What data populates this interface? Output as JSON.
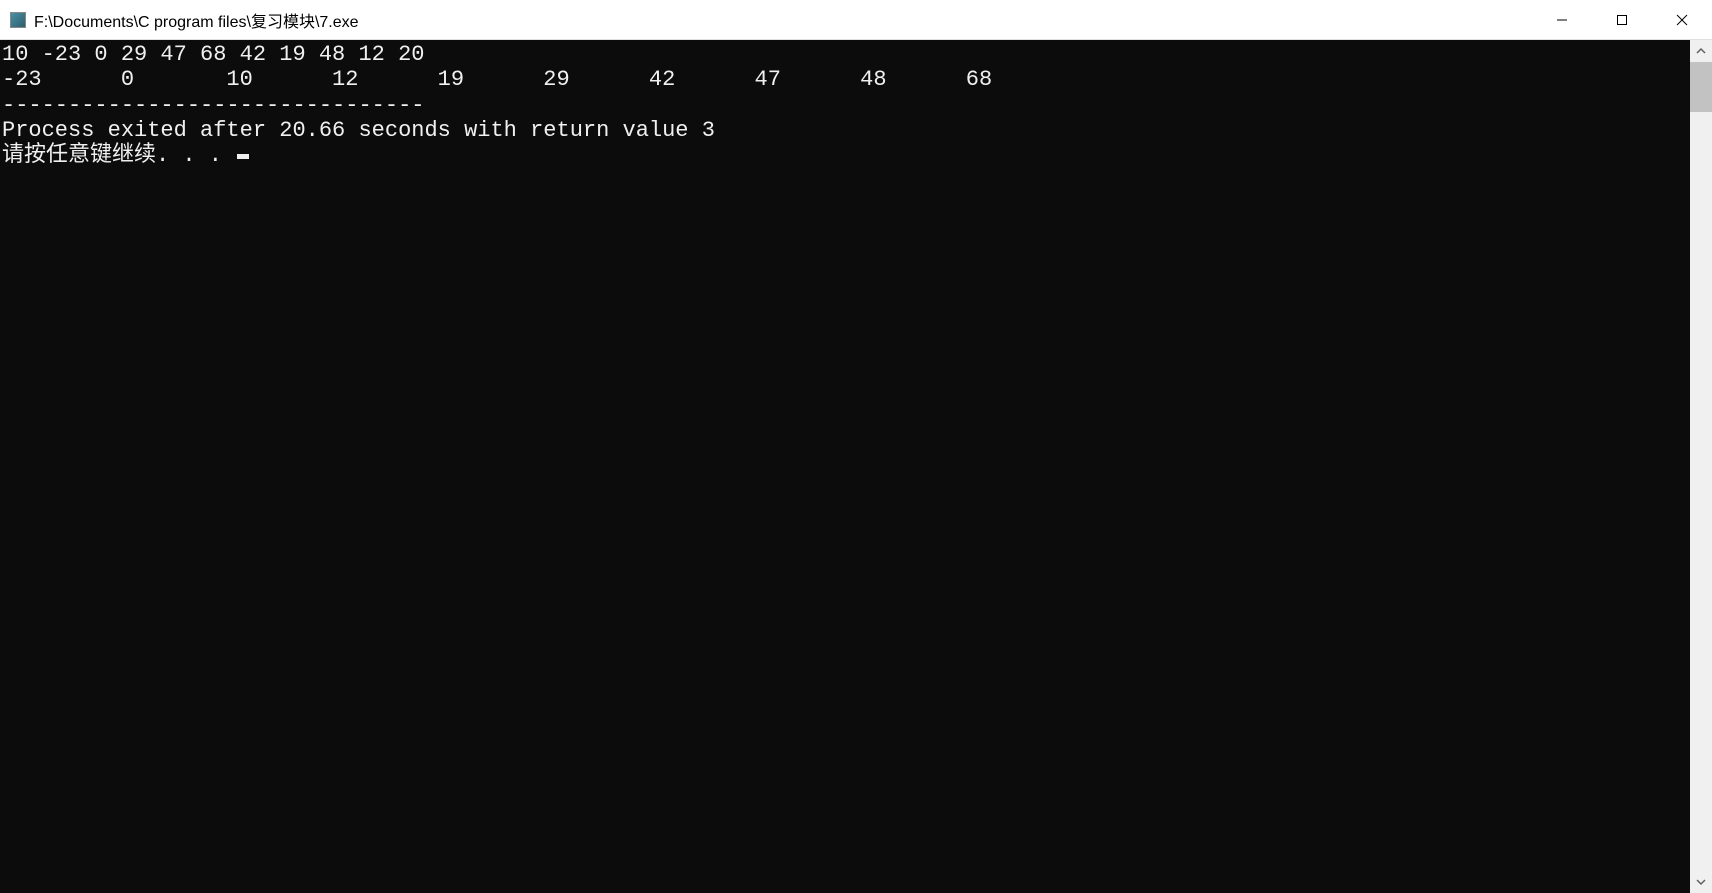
{
  "window": {
    "title": "F:\\Documents\\C program files\\复习模块\\7.exe"
  },
  "terminal": {
    "lines": [
      "10 -23 0 29 47 68 42 19 48 12 20",
      "-23      0       10      12      19      29      42      47      48      68",
      "--------------------------------",
      "Process exited after 20.66 seconds with return value 3"
    ],
    "prompt": "请按任意键继续. . . "
  }
}
